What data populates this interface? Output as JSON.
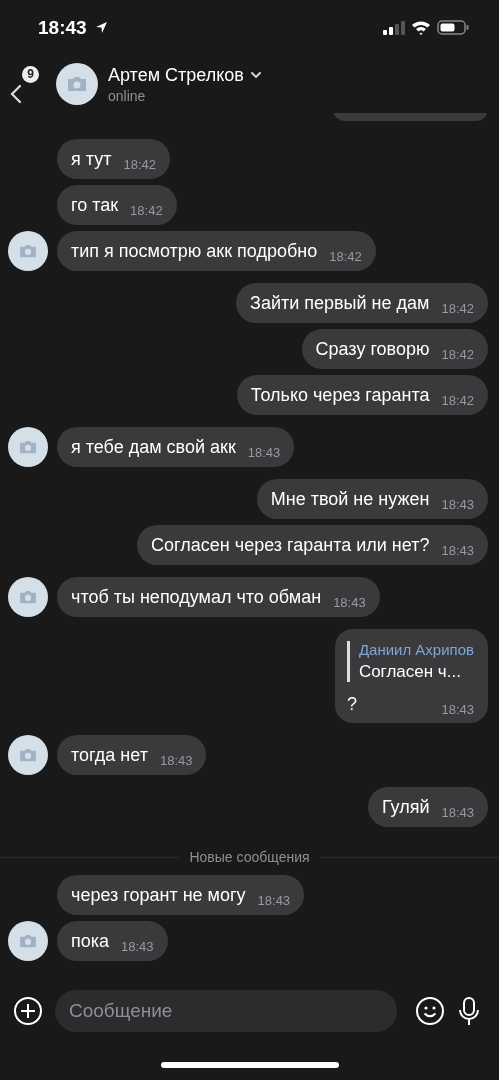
{
  "status_bar": {
    "time": "18:43"
  },
  "header": {
    "back_badge": "9",
    "name": "Артем Стрелков",
    "status": "online"
  },
  "messages": [
    {
      "kind": "cut"
    },
    {
      "kind": "incoming",
      "text": "я тут",
      "time": "18:42",
      "avatar": false
    },
    {
      "kind": "incoming",
      "text": "го так",
      "time": "18:42",
      "avatar": false
    },
    {
      "kind": "incoming",
      "text": "тип я посмотрю акк подробно",
      "time": "18:42",
      "avatar": true
    },
    {
      "kind": "outgoing",
      "text": "Зайти первый не дам",
      "time": "18:42"
    },
    {
      "kind": "outgoing",
      "text": "Сразу говорю",
      "time": "18:42"
    },
    {
      "kind": "outgoing",
      "text": "Только через гаранта",
      "time": "18:42"
    },
    {
      "kind": "incoming",
      "text": "я тебе дам свой акк",
      "time": "18:43",
      "avatar": true
    },
    {
      "kind": "outgoing",
      "text": "Мне твой не нужен",
      "time": "18:43"
    },
    {
      "kind": "outgoing",
      "text": "Согласен через гаранта или нет?",
      "time": "18:43"
    },
    {
      "kind": "incoming",
      "text": "чтоб ты неподумал что обман",
      "time": "18:43",
      "avatar": true
    },
    {
      "kind": "outgoing",
      "text": "?",
      "time": "18:43",
      "reply": {
        "author": "Даниил Ахрипов",
        "text": "Согласен ч..."
      }
    },
    {
      "kind": "incoming",
      "text": "тогда нет",
      "time": "18:43",
      "avatar": true
    },
    {
      "kind": "outgoing",
      "text": "Гуляй",
      "time": "18:43"
    },
    {
      "kind": "divider",
      "text": "Новые сообщения"
    },
    {
      "kind": "incoming",
      "text": "через горант не могу",
      "time": "18:43",
      "avatar": false
    },
    {
      "kind": "incoming",
      "text": "пока",
      "time": "18:43",
      "avatar": true
    }
  ],
  "composer": {
    "placeholder": "Сообщение"
  }
}
